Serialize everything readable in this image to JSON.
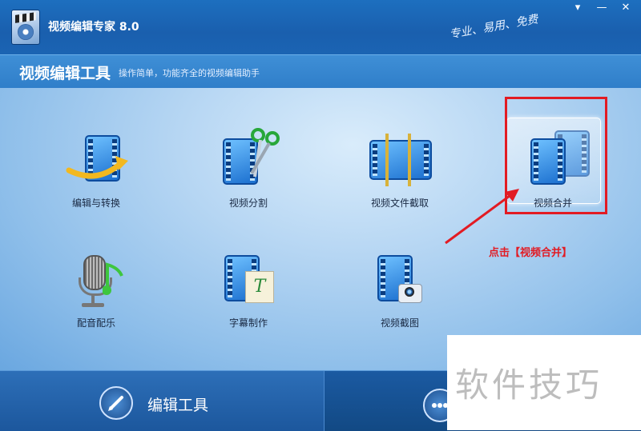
{
  "app": {
    "title": "视频编辑专家 8.0",
    "slogan": "专业、易用、免费"
  },
  "window_controls": {
    "menu": "▾",
    "minimize": "—",
    "close": "✕"
  },
  "header": {
    "title": "视频编辑工具",
    "subtitle": "操作简单，功能齐全的视频编辑助手"
  },
  "tools": [
    {
      "label": "编辑与转换",
      "icon": "film-convert-icon"
    },
    {
      "label": "视频分割",
      "icon": "film-scissors-icon"
    },
    {
      "label": "视频文件截取",
      "icon": "film-trim-icon"
    },
    {
      "label": "视频合并",
      "icon": "film-merge-icon",
      "selected": true
    },
    {
      "label": "配音配乐",
      "icon": "microphone-music-icon"
    },
    {
      "label": "字幕制作",
      "icon": "film-subtitle-icon"
    },
    {
      "label": "视频截图",
      "icon": "film-camera-icon"
    }
  ],
  "annotation": {
    "text": "点击【视频合并】",
    "color": "#e21b23"
  },
  "bottom_tabs": {
    "edit_tools": "编辑工具"
  },
  "watermark": "软件技巧",
  "colors": {
    "accent": "#1d6fbf",
    "highlight": "#e21b23"
  }
}
